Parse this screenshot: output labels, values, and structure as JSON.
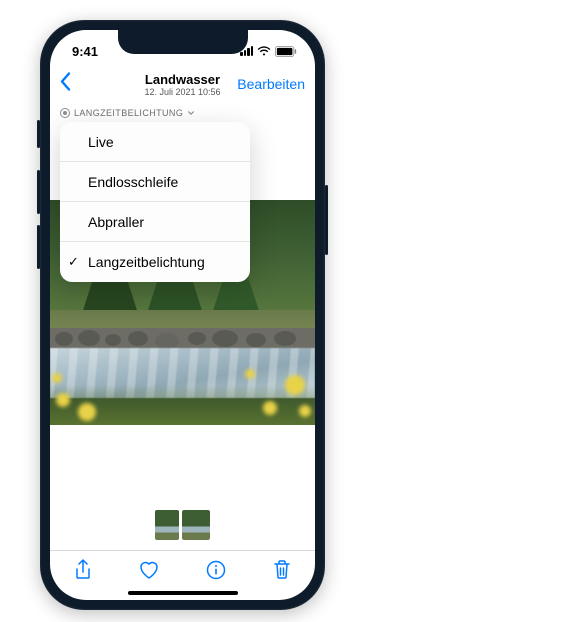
{
  "status": {
    "time": "9:41"
  },
  "nav": {
    "title": "Landwasser",
    "subtitle": "12. Juli 2021 10:56",
    "edit": "Bearbeiten"
  },
  "chip": {
    "label": "LANGZEITBELICHTUNG"
  },
  "menu": {
    "items": [
      {
        "label": "Live",
        "checked": false
      },
      {
        "label": "Endlosschleife",
        "checked": false
      },
      {
        "label": "Abpraller",
        "checked": false
      },
      {
        "label": "Langzeitbelichtung",
        "checked": true
      }
    ]
  }
}
